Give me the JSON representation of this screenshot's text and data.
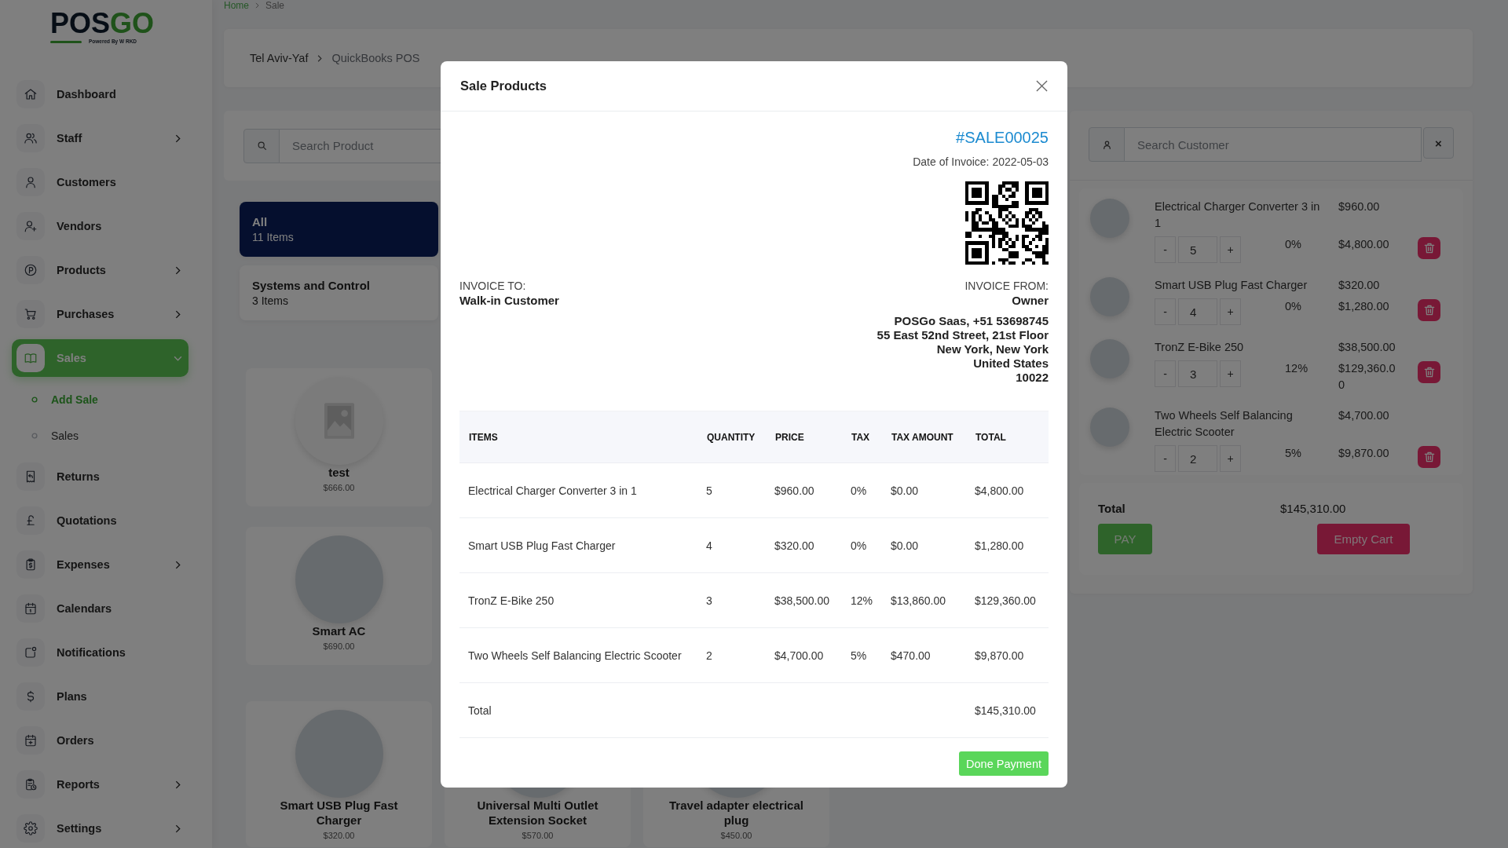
{
  "logo": {
    "wordmark_dark": "POS",
    "wordmark_green": "GO",
    "tagline": "Powered By W RKD"
  },
  "sidebar": {
    "items": [
      {
        "label": "Dashboard",
        "selected": false,
        "expandable": false,
        "expanded": false
      },
      {
        "label": "Staff",
        "selected": false,
        "expandable": true,
        "expanded": false
      },
      {
        "label": "Customers",
        "selected": false,
        "expandable": false,
        "expanded": false
      },
      {
        "label": "Vendors",
        "selected": false,
        "expandable": false,
        "expanded": false
      },
      {
        "label": "Products",
        "selected": false,
        "expandable": true,
        "expanded": false
      },
      {
        "label": "Purchases",
        "selected": false,
        "expandable": true,
        "expanded": false
      },
      {
        "label": "Sales",
        "selected": true,
        "expandable": true,
        "expanded": true,
        "children": [
          {
            "label": "Add Sale",
            "selected": true
          },
          {
            "label": "Sales",
            "selected": false
          }
        ]
      },
      {
        "label": "Returns",
        "selected": false,
        "expandable": false,
        "expanded": false
      },
      {
        "label": "Quotations",
        "selected": false,
        "expandable": false,
        "expanded": false
      },
      {
        "label": "Expenses",
        "selected": false,
        "expandable": true,
        "expanded": false
      },
      {
        "label": "Calendars",
        "selected": false,
        "expandable": false,
        "expanded": false
      },
      {
        "label": "Notifications",
        "selected": false,
        "expandable": false,
        "expanded": false
      },
      {
        "label": "Plans",
        "selected": false,
        "expandable": false,
        "expanded": false
      },
      {
        "label": "Orders",
        "selected": false,
        "expandable": false,
        "expanded": false
      },
      {
        "label": "Reports",
        "selected": false,
        "expandable": true,
        "expanded": false
      },
      {
        "label": "Settings",
        "selected": false,
        "expandable": true,
        "expanded": false
      }
    ]
  },
  "breadcrumb": [
    {
      "label": "Home",
      "kind": "link"
    },
    {
      "label": "Sale",
      "kind": "current"
    }
  ],
  "location": {
    "items": [
      "Tel Aviv-Yaf",
      "QuickBooks POS"
    ]
  },
  "product_search": {
    "placeholder": "Search Product"
  },
  "categories": [
    {
      "name": "All",
      "count": "11 Items",
      "selected": true
    },
    {
      "name": "Systems and Control",
      "count": "3 Items",
      "selected": false
    }
  ],
  "product_rows": [
    [
      {
        "name": "test",
        "price": "$666.00",
        "kind": "no-image"
      }
    ],
    [
      {
        "name": "Smart AC",
        "price": "$690.00",
        "kind": "photo"
      }
    ],
    [
      {
        "name": "Smart USB Plug Fast Charger",
        "price": "$320.00",
        "kind": "photo"
      },
      {
        "name": "Universal Multi Outlet Extension Socket",
        "price": "$570.00",
        "kind": "photo"
      },
      {
        "name": "Travel adapter electrical plug",
        "price": "$450.00",
        "kind": "photo"
      }
    ]
  ],
  "cart": {
    "customer_search": {
      "placeholder": "Search Customer"
    },
    "clear_label": "×",
    "items": [
      {
        "name": "Electrical Charger Converter 3 in 1",
        "price": "$960.00",
        "decrease": "-",
        "quantity": "5",
        "increase": "+",
        "tax": "0%",
        "line_total": "$4,800.00"
      },
      {
        "name": "Smart USB Plug Fast Charger",
        "price": "$320.00",
        "decrease": "-",
        "quantity": "4",
        "increase": "+",
        "tax": "0%",
        "line_total": "$1,280.00"
      },
      {
        "name": "TronZ E-Bike 250",
        "price": "$38,500.00",
        "decrease": "-",
        "quantity": "3",
        "increase": "+",
        "tax": "12%",
        "line_total": "$129,360.00"
      },
      {
        "name": "Two Wheels Self Balancing Electric Scooter",
        "price": "$4,700.00",
        "decrease": "-",
        "quantity": "2",
        "increase": "+",
        "tax": "5%",
        "line_total": "$9,870.00"
      }
    ],
    "total_label": "Total",
    "total": "$145,310.00",
    "buttons": [
      {
        "label": "PAY",
        "kind": "pay"
      },
      {
        "label": "Empty Cart",
        "kind": "empty"
      }
    ]
  },
  "dialog": {
    "title": "Sale Products",
    "invoice_number": "#SALE00025",
    "invoice_date": "Date of Invoice: 2022-05-03",
    "invoice_to": {
      "label": "INVOICE TO:",
      "name": "Walk-in Customer"
    },
    "invoice_from": {
      "label": "INVOICE FROM:",
      "name": "Owner",
      "address_lines": [
        "POSGo Saas, +51 53698745",
        "55 East 52nd Street, 21st Floor",
        "New York, New York",
        "United States",
        "10022"
      ]
    },
    "table": {
      "columns": [
        "ITEMS",
        "QUANTITY",
        "PRICE",
        "TAX",
        "TAX AMOUNT",
        "TOTAL"
      ],
      "rows": [
        [
          "Electrical Charger Converter 3 in 1",
          "5",
          "$960.00",
          "0%",
          "$0.00",
          "$4,800.00"
        ],
        [
          "Smart USB Plug Fast Charger",
          "4",
          "$320.00",
          "0%",
          "$0.00",
          "$1,280.00"
        ],
        [
          "TronZ E-Bike 250",
          "3",
          "$38,500.00",
          "12%",
          "$13,860.00",
          "$129,360.00"
        ],
        [
          "Two Wheels Self Balancing Electric Scooter",
          "2",
          "$4,700.00",
          "5%",
          "$470.00",
          "$9,870.00"
        ]
      ],
      "total_label": "Total",
      "total": "$145,310.00"
    },
    "button": "Done Payment"
  }
}
